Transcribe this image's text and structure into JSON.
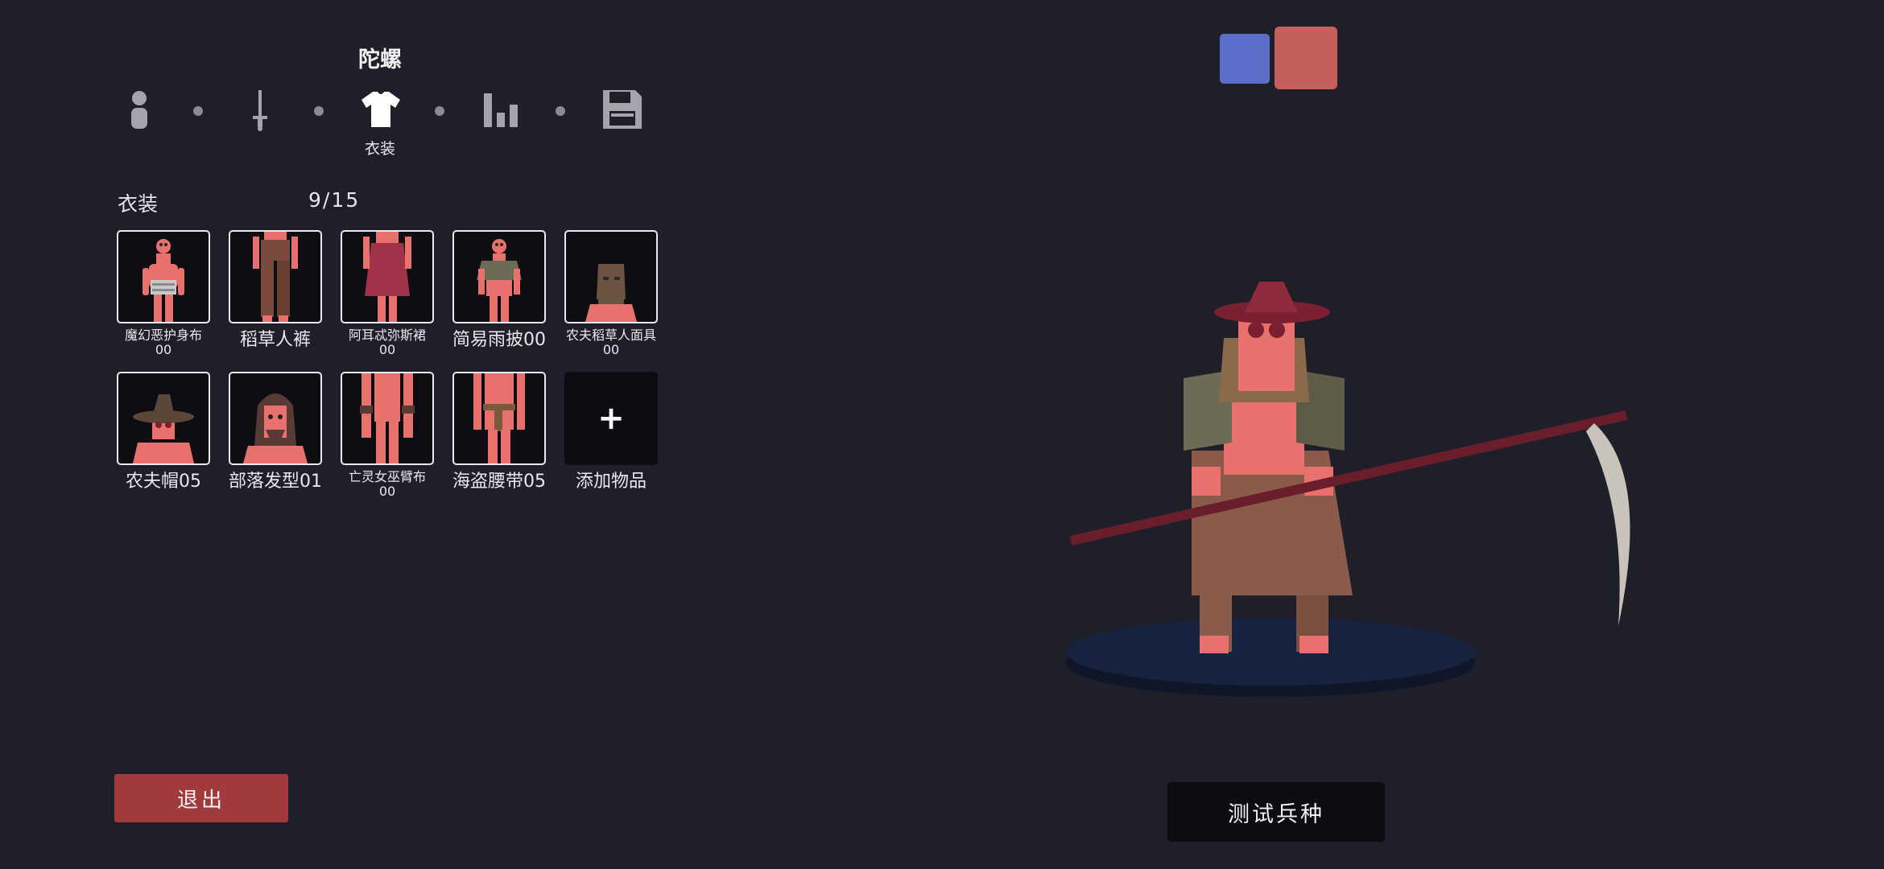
{
  "header": {
    "title": "陀螺"
  },
  "steps": {
    "icons": [
      "person-icon",
      "sword-icon",
      "shirt-icon",
      "stats-icon",
      "save-icon"
    ],
    "active_label": "衣装"
  },
  "section": {
    "label": "衣装",
    "count": "9/15"
  },
  "items": [
    {
      "name_line1": "魔幻恶护身布",
      "name_line2": "00"
    },
    {
      "name_line1": "稻草人裤",
      "name_line2": ""
    },
    {
      "name_line1": "阿耳忒弥斯裙",
      "name_line2": "00"
    },
    {
      "name_line1": "简易雨披00",
      "name_line2": ""
    },
    {
      "name_line1": "农夫稻草人面具",
      "name_line2": "00"
    },
    {
      "name_line1": "农夫帽05",
      "name_line2": ""
    },
    {
      "name_line1": "部落发型01",
      "name_line2": ""
    },
    {
      "name_line1": "亡灵女巫臂布",
      "name_line2": "00"
    },
    {
      "name_line1": "海盗腰带05",
      "name_line2": ""
    }
  ],
  "add_item": {
    "symbol": "+",
    "label": "添加物品"
  },
  "buttons": {
    "exit": "退出",
    "test": "测试兵种"
  },
  "colors": {
    "team_blue": "#5b6ec8",
    "team_red": "#c65e5c",
    "unit_skin": "#e8716d"
  }
}
